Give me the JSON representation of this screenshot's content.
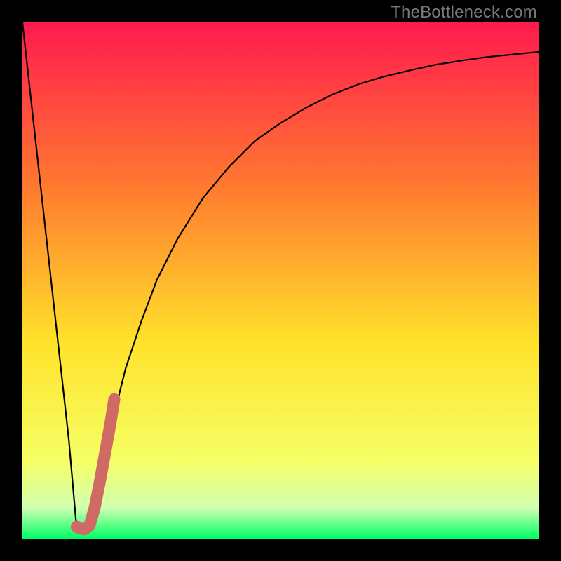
{
  "watermark": "TheBottleneck.com",
  "colors": {
    "gradient_top": "#ff1a4e",
    "gradient_mid1": "#ff7a2f",
    "gradient_mid2": "#ffe22a",
    "gradient_mid3": "#f6ff66",
    "gradient_bottom_band": "#d2ffb0",
    "gradient_bottom": "#00ff66",
    "curve": "#000000",
    "highlight": "#cf6a64",
    "frame": "#000000"
  },
  "chart_data": {
    "type": "line",
    "title": "",
    "xlabel": "",
    "ylabel": "",
    "xlim": [
      0,
      100
    ],
    "ylim": [
      0,
      100
    ],
    "series": [
      {
        "name": "curve",
        "x": [
          0,
          3,
          6,
          9,
          10.5,
          12,
          14,
          16,
          18,
          20,
          23,
          26,
          30,
          35,
          40,
          45,
          50,
          55,
          60,
          65,
          70,
          75,
          80,
          85,
          90,
          95,
          100
        ],
        "y": [
          100,
          73,
          46,
          19,
          2,
          1,
          7,
          16,
          25,
          33,
          42,
          50,
          58,
          66,
          72,
          77,
          80.5,
          83.5,
          86,
          88,
          89.5,
          90.7,
          91.8,
          92.6,
          93.3,
          93.8,
          94.3
        ]
      },
      {
        "name": "highlight-hook",
        "x": [
          10.5,
          11,
          12,
          13,
          14,
          15,
          16,
          17,
          17.8
        ],
        "y": [
          2.3,
          2,
          1.8,
          2.5,
          6,
          11,
          16.5,
          22,
          27
        ]
      }
    ]
  }
}
